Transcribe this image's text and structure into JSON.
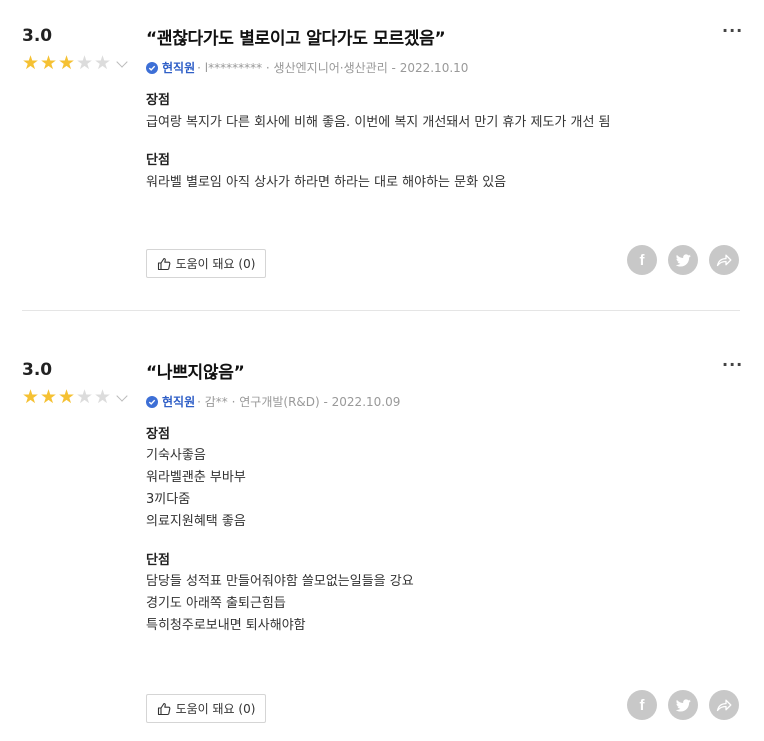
{
  "reviews": [
    {
      "rating": "3.0",
      "stars": 3,
      "title": "“괜찮다가도 별로이고 알다가도 모르겠음”",
      "employee_status": "현직원",
      "meta": "· l********* · 생산엔지니어·생산관리 - 2022.10.10",
      "pros_label": "장점",
      "pros": [
        "급여랑 복지가 다른 회사에 비해 좋음. 이번에 복지 개선돼서 만기 휴가 제도가 개선 됨"
      ],
      "cons_label": "단점",
      "cons": [
        "워라벨 별로임 아직 상사가 하라면 하라는 대로 해야하는 문화 있음"
      ],
      "helpful_label": "도움이 돼요 (0)"
    },
    {
      "rating": "3.0",
      "stars": 3,
      "title": "“나쁘지않음”",
      "employee_status": "현직원",
      "meta": "· 감** · 연구개발(R&D) - 2022.10.09",
      "pros_label": "장점",
      "pros": [
        "기숙사좋음",
        "워라벨괜춘 부바부",
        "3끼다줌",
        "의료지원혜택 좋음"
      ],
      "cons_label": "단점",
      "cons": [
        "담당들 성적표 만들어줘야함 쓸모없는일들을 강요",
        "경기도 아래쪽 출퇴근힘듭",
        "특히청주로보내면 퇴사해야함"
      ],
      "helpful_label": "도움이 돼요 (0)"
    }
  ],
  "icons": {
    "more": "more-options-icon",
    "facebook": "facebook-icon",
    "twitter": "twitter-icon",
    "share": "share-icon",
    "thumbs_up": "thumbs-up-icon",
    "verified": "verified-check-icon"
  },
  "colors": {
    "star_on": "#f5c133",
    "star_off": "#dcdcdc",
    "employee": "#2f5fc7",
    "share_bg": "#c8c8c8"
  }
}
